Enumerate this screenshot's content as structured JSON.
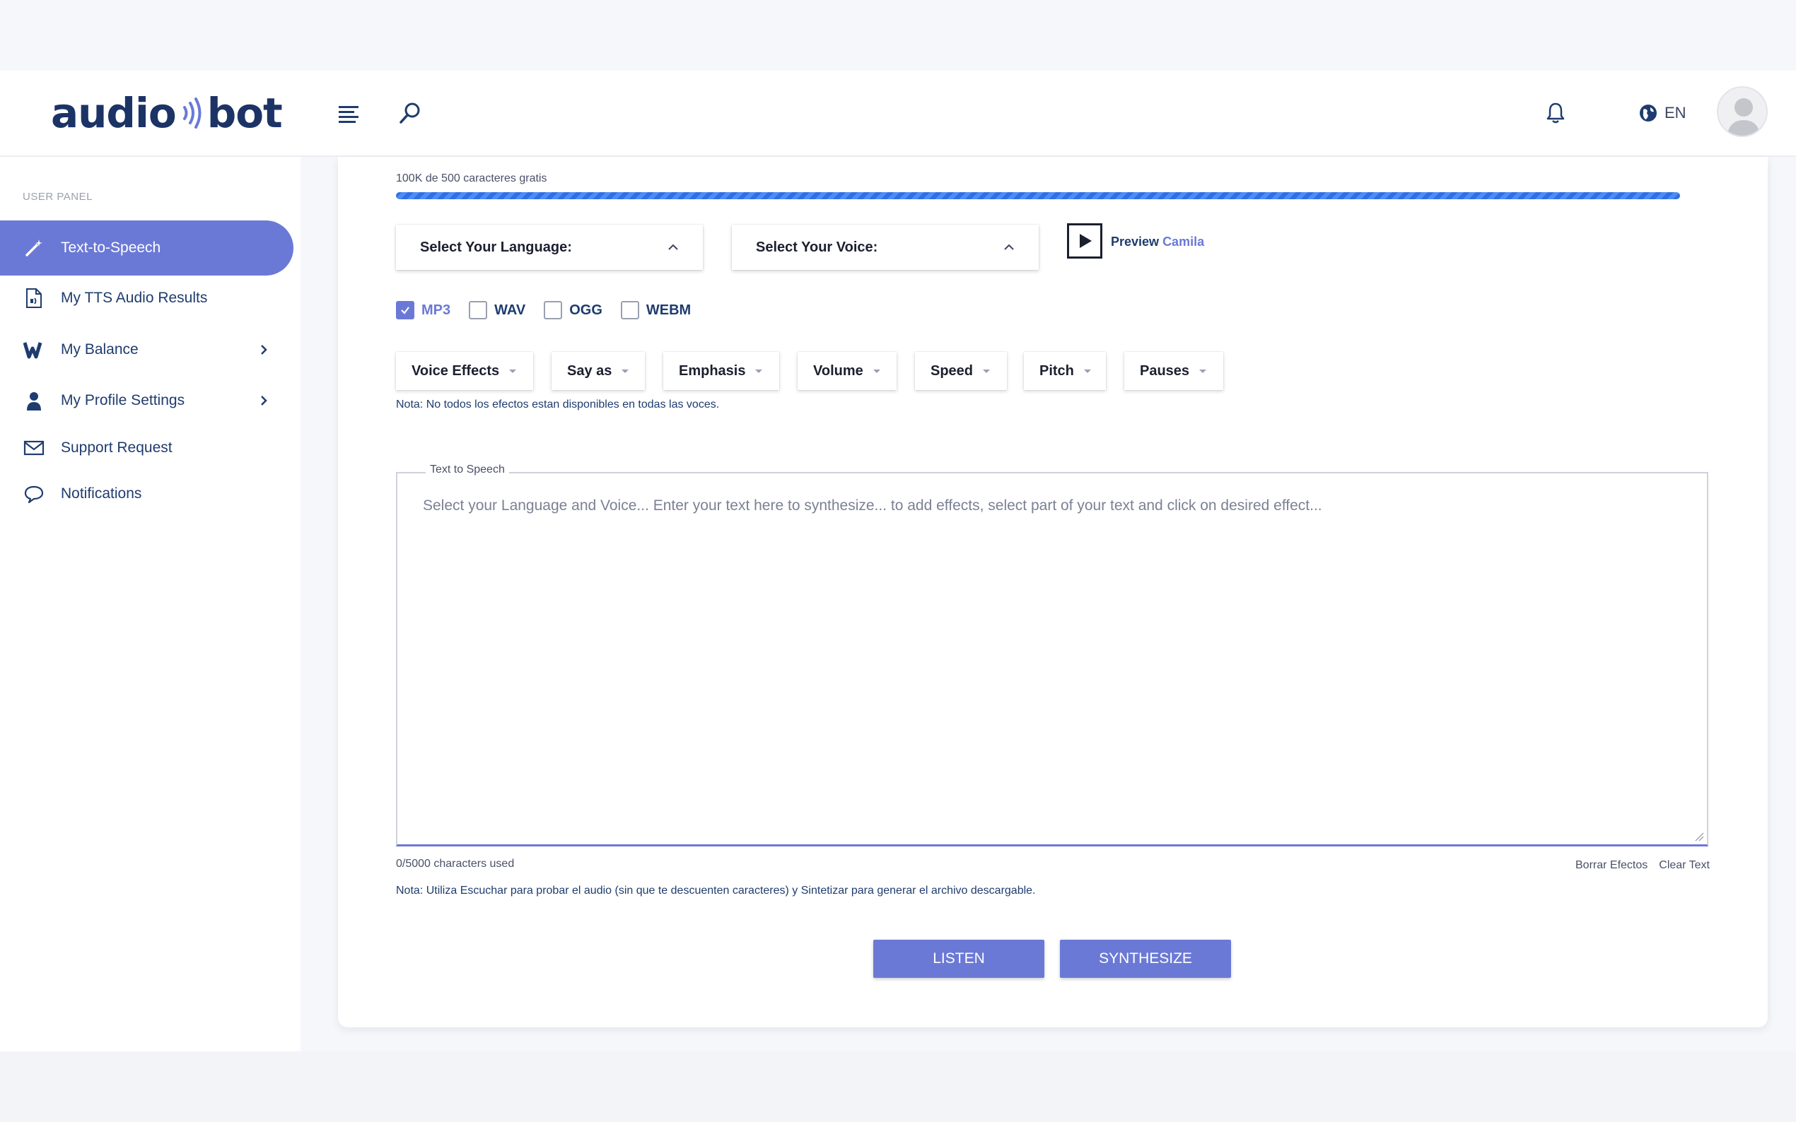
{
  "header": {
    "logo_left": "audio",
    "logo_right": "bot",
    "language_code": "EN"
  },
  "sidebar": {
    "panel_label": "USER PANEL",
    "items": [
      {
        "label": "Text-to-Speech",
        "icon": "magic-wand-icon",
        "active": true
      },
      {
        "label": "My TTS Audio Results",
        "icon": "audio-file-icon"
      },
      {
        "label": "My Balance",
        "icon": "wallet-icon",
        "has_submenu": true
      },
      {
        "label": "My Profile Settings",
        "icon": "user-icon",
        "has_submenu": true
      },
      {
        "label": "Support Request",
        "icon": "envelope-icon"
      },
      {
        "label": "Notifications",
        "icon": "chat-bubble-icon"
      }
    ]
  },
  "main": {
    "quota_text": "100K de 500 caracteres gratis",
    "quota_progress": 1.0,
    "language_dropdown": "Select Your Language:",
    "voice_dropdown": "Select Your Voice:",
    "preview_label": "Preview",
    "preview_voice": "Camila",
    "formats": [
      {
        "label": "MP3",
        "checked": true
      },
      {
        "label": "WAV",
        "checked": false
      },
      {
        "label": "OGG",
        "checked": false
      },
      {
        "label": "WEBM",
        "checked": false
      }
    ],
    "effects": [
      "Voice Effects",
      "Say as",
      "Emphasis",
      "Volume",
      "Speed",
      "Pitch",
      "Pauses"
    ],
    "effects_note": "Nota: No todos los efectos estan disponibles en todas las voces.",
    "tts_legend": "Text to Speech",
    "tts_placeholder": "Select your Language and Voice... Enter your text here to synthesize... to add effects, select part of your text and click on desired effect...",
    "chars_used": "0/5000 characters used",
    "clear_effects": "Borrar Efectos",
    "clear_text": "Clear Text",
    "usage_note": "Nota: Utiliza Escuchar para probar el audio (sin que te descuenten caracteres) y Sintetizar para generar el archivo descargable.",
    "listen_label": "LISTEN",
    "synthesize_label": "SYNTHESIZE"
  },
  "colors": {
    "accent": "#6b79d6",
    "navy": "#1f3c6e",
    "progress": "#2f6fe6"
  }
}
